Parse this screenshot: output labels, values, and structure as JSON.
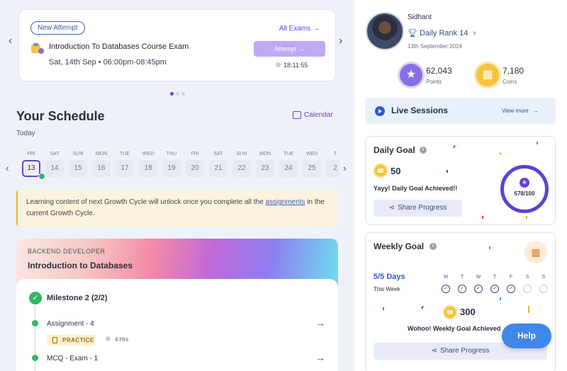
{
  "exam": {
    "badge": "New Attempt",
    "all_exams": "All Exams",
    "title": "Introduction To Databases Course Exam",
    "date": "Sat, 14th Sep",
    "time": "06:00pm-08:45pm",
    "attempt": "Attempt",
    "timer": "18:11:55"
  },
  "schedule": {
    "title": "Your Schedule",
    "calendar": "Calendar",
    "today": "Today",
    "days": [
      {
        "dow": "FRI",
        "num": "13"
      },
      {
        "dow": "SAT",
        "num": "14"
      },
      {
        "dow": "SUN",
        "num": "15"
      },
      {
        "dow": "MON",
        "num": "16"
      },
      {
        "dow": "TUE",
        "num": "17"
      },
      {
        "dow": "WED",
        "num": "18"
      },
      {
        "dow": "THU",
        "num": "19"
      },
      {
        "dow": "FRI",
        "num": "20"
      },
      {
        "dow": "SAT",
        "num": "21"
      },
      {
        "dow": "SUN",
        "num": "22"
      },
      {
        "dow": "MON",
        "num": "23"
      },
      {
        "dow": "TUE",
        "num": "24"
      },
      {
        "dow": "WED",
        "num": "25"
      },
      {
        "dow": "T",
        "num": "2"
      }
    ],
    "notice_pre": "Learning content of next Growth Cycle will unlock once you complete all the ",
    "notice_link": "assignments",
    "notice_post": " in the current Growth Cycle."
  },
  "course": {
    "label": "BACKEND DEVELOPER",
    "name": "Introduction to Databases",
    "milestone": "Milestone 2 (2/2)",
    "items": [
      {
        "title": "Assignment - 4",
        "tag": "PRACTICE",
        "duration": "4 Hrs"
      },
      {
        "title": "MCQ - Exam - 1"
      }
    ]
  },
  "profile": {
    "name": "Sidhant",
    "rank": "Daily Rank 14",
    "date": "13th September 2024",
    "points_value": "62,043",
    "points_label": "Points",
    "coins_value": "7,180",
    "coins_label": "Coins"
  },
  "live": {
    "title": "Live Sessions",
    "view_more": "View more"
  },
  "daily_goal": {
    "title": "Daily Goal",
    "coins": "50",
    "message": "Yayy! Daily Goal Achieved!!",
    "share": "Share Progress",
    "progress": "578/100"
  },
  "weekly_goal": {
    "title": "Weekly Goal",
    "days": "5/5 Days",
    "this_week": "This Week",
    "weekdays": [
      {
        "label": "M",
        "done": true
      },
      {
        "label": "T",
        "done": true
      },
      {
        "label": "W",
        "done": true
      },
      {
        "label": "T",
        "done": true
      },
      {
        "label": "F",
        "done": true
      },
      {
        "label": "S",
        "done": false
      },
      {
        "label": "S",
        "done": false
      }
    ],
    "coins": "300",
    "message": "Wohoo! Weekly Goal Achieved",
    "share": "Share Progress"
  },
  "help": "Help",
  "colors": {
    "accent": "#6a3fd9",
    "link": "#3c5bb8",
    "success": "#35b560",
    "help": "#3f87e8"
  }
}
